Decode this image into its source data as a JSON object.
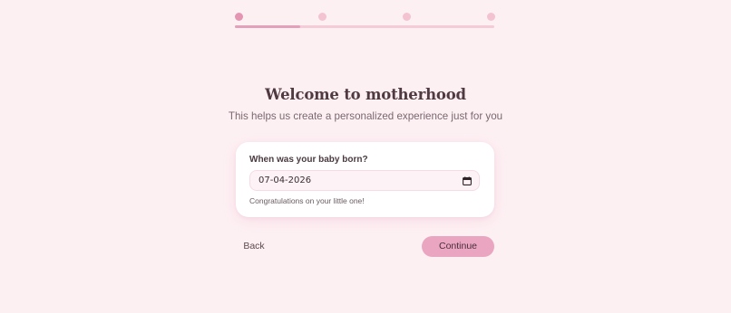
{
  "stepper": {
    "total_steps": 4,
    "current_step": 1,
    "progress_fraction": 0.25
  },
  "heading": {
    "title": "Welcome to motherhood",
    "subtitle": "This helps us create a personalized experience just for you"
  },
  "form": {
    "question_label": "When was your baby born?",
    "date_value": "07-04-2026",
    "hint": "Congratulations on your little one!",
    "calendar_icon": "calendar-icon"
  },
  "actions": {
    "back_label": "Back",
    "continue_label": "Continue"
  },
  "colors": {
    "background": "#fdf0f3",
    "accent": "#eaa6c1",
    "dot_active": "#e495b2",
    "dot_inactive": "#f3c3d2"
  }
}
